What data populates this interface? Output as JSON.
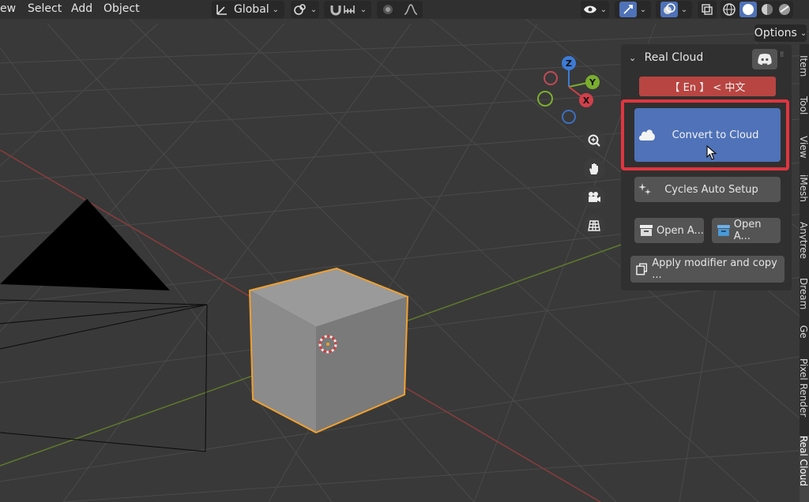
{
  "menu": [
    "ew",
    "Select",
    "Add",
    "Object"
  ],
  "header": {
    "transform_orientation": "Global",
    "options_label": "Options"
  },
  "axes": {
    "z": "Z",
    "y": "Y",
    "x": "X"
  },
  "npanel": {
    "title": "Real Cloud",
    "lang_toggle": "【 En 】 <  中文",
    "convert_label": "Convert to Cloud",
    "cycles_label": "Cycles Auto Setup",
    "open_a_1": "Open A...",
    "open_a_2": "Open A...",
    "apply_label": "Apply modifier and copy ..."
  },
  "sidebar_tabs": [
    "Item",
    "Tool",
    "View",
    "iMesh",
    "Anytree",
    "Dream",
    "Ge",
    "Pixel Render",
    "Real Cloud"
  ],
  "colors": {
    "accent_blue": "#4f72b8",
    "highlight_red": "#e1353f",
    "lang_red": "#b84541",
    "selection_orange": "#f0a030"
  }
}
